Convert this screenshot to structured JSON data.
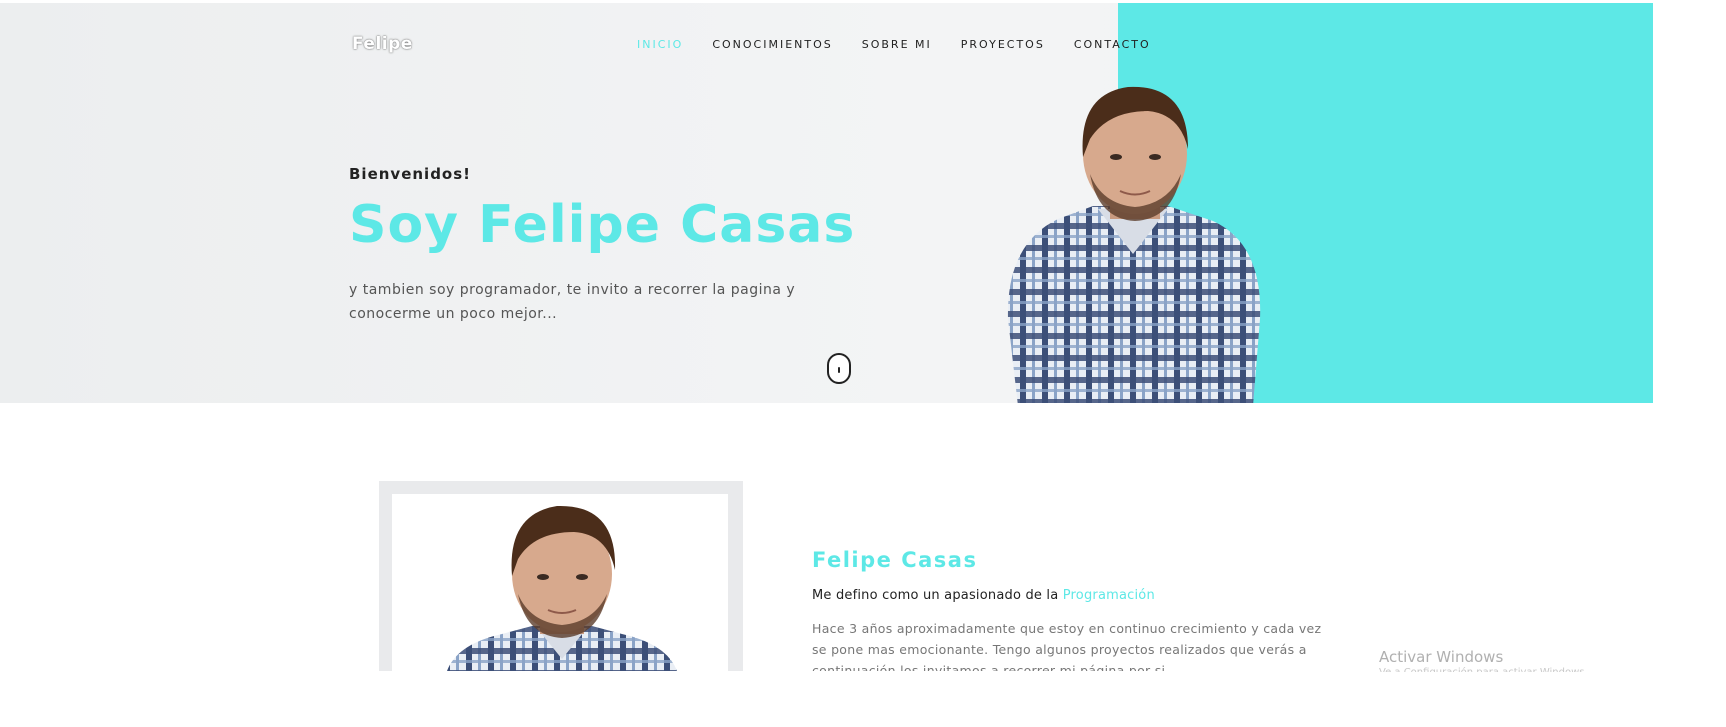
{
  "brand": {
    "logo_text": "Felipe"
  },
  "nav": {
    "items": [
      {
        "label": "INICIO",
        "active": true
      },
      {
        "label": "CONOCIMIENTOS",
        "active": false
      },
      {
        "label": "SOBRE MI",
        "active": false
      },
      {
        "label": "PROYECTOS",
        "active": false
      },
      {
        "label": "CONTACTO",
        "active": false
      }
    ]
  },
  "hero": {
    "greeting": "Bienvenidos!",
    "title": "Soy Felipe Casas",
    "subtitle": "y tambien soy programador, te invito a recorrer la pagina y conocerme un poco mejor..."
  },
  "about": {
    "name": "Felipe Casas",
    "tagline_prefix": "Me defino como un apasionado de la ",
    "tagline_highlight": "Programación",
    "body": "Hace 3 años aproximadamente que estoy en continuo crecimiento y cada vez se pone mas emocionante. Tengo algunos proyectos realizados que verás a continuación los invitamos a recorrer mi página por si"
  },
  "watermark": {
    "title": "Activar Windows",
    "subtitle": "Ve a Configuración para activar Windows."
  },
  "colors": {
    "accent": "#5de8e6",
    "text": "#222222",
    "muted": "#777777"
  },
  "icons": {
    "scroll": "mouse-scroll-icon"
  }
}
